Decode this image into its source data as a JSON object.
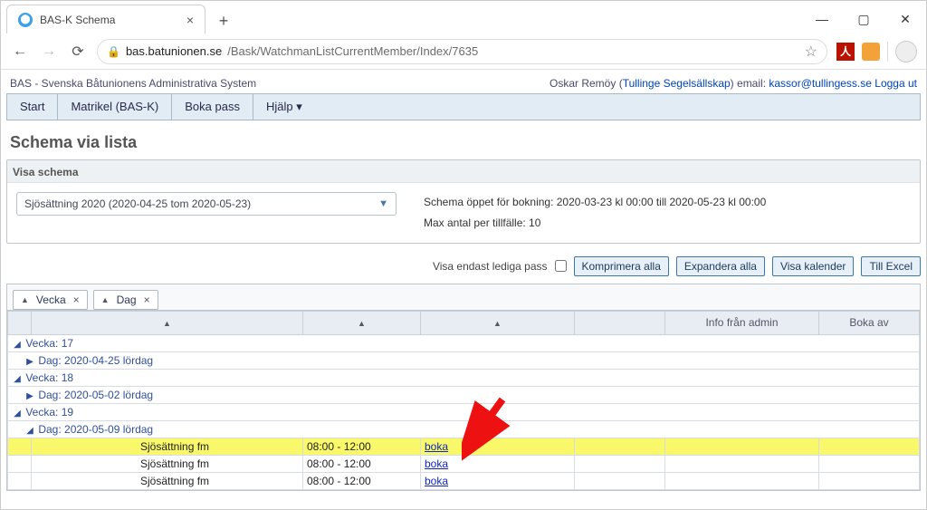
{
  "browser": {
    "tab_title": "BAS-K Schema",
    "url_host": "bas.batunionen.se",
    "url_path": "/Bask/WatchmanListCurrentMember/Index/7635"
  },
  "sys": {
    "app_name": "BAS - Svenska Båtunionens Administrativa System",
    "user_name": "Oskar Remöy",
    "user_club": "Tullinge Segelsällskap",
    "email_label": "email:",
    "user_email": "kassor@tullingess.se",
    "logout": "Logga ut"
  },
  "menu": {
    "start": "Start",
    "matrikel": "Matrikel (BAS-K)",
    "boka": "Boka pass",
    "hjalp": "Hjälp ▾"
  },
  "page": {
    "title": "Schema via lista",
    "visa_schema_label": "Visa schema",
    "schema_dropdown": "Sjösättning 2020 (2020-04-25 tom 2020-05-23)",
    "booking_open": "Schema öppet för bokning: 2020-03-23 kl 00:00 till 2020-05-23 kl 00:00",
    "max_antal": "Max antal per tillfälle: 10",
    "only_free_label": "Visa endast lediga pass",
    "btn_komprimera": "Komprimera alla",
    "btn_expandera": "Expandera alla",
    "btn_kalender": "Visa kalender",
    "btn_excel": "Till Excel"
  },
  "grid": {
    "tabs": {
      "vecka": "Vecka",
      "dag": "Dag"
    },
    "headers": {
      "info": "Info från admin",
      "boka_av": "Boka av"
    },
    "groups": [
      {
        "type": "week",
        "label": "Vecka: 17",
        "expanded": true
      },
      {
        "type": "day",
        "label": "Dag: 2020-04-25 lördag",
        "expanded": false,
        "level": 1
      },
      {
        "type": "week",
        "label": "Vecka: 18",
        "expanded": true
      },
      {
        "type": "day",
        "label": "Dag: 2020-05-02 lördag",
        "expanded": false,
        "level": 1
      },
      {
        "type": "week",
        "label": "Vecka: 19",
        "expanded": true
      },
      {
        "type": "day",
        "label": "Dag: 2020-05-09 lördag",
        "expanded": true,
        "level": 1
      }
    ],
    "rows": [
      {
        "name": "Sjösättning fm",
        "time": "08:00 - 12:00",
        "action": "boka",
        "highlight": true
      },
      {
        "name": "Sjösättning fm",
        "time": "08:00 - 12:00",
        "action": "boka",
        "highlight": false
      },
      {
        "name": "Sjösättning fm",
        "time": "08:00 - 12:00",
        "action": "boka",
        "highlight": false
      }
    ]
  }
}
